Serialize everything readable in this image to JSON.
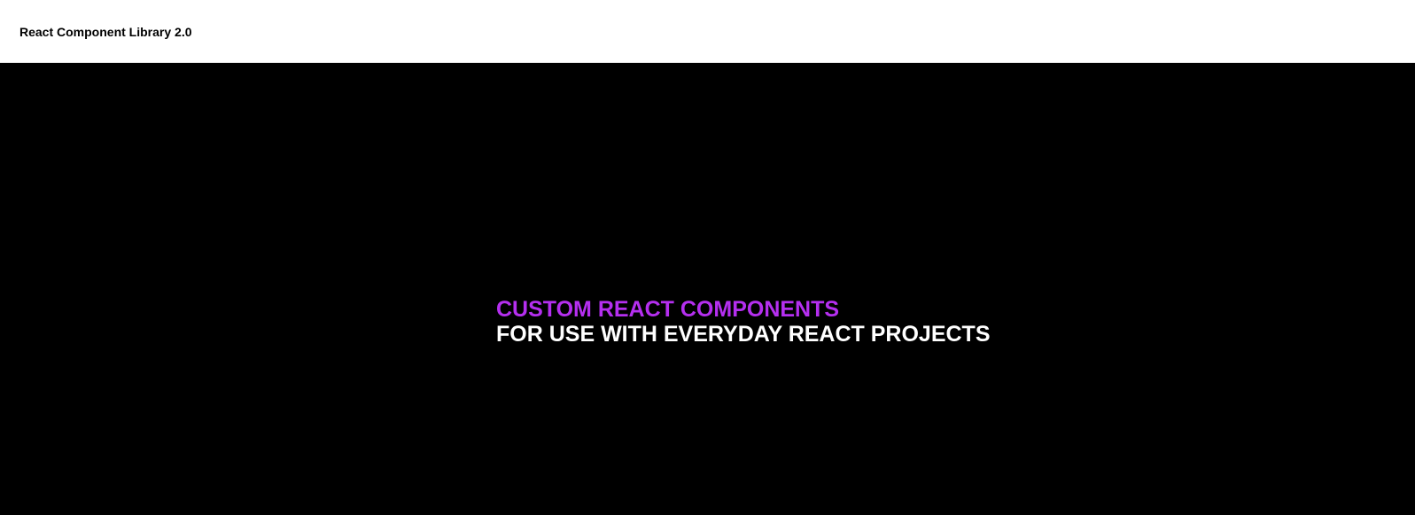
{
  "header": {
    "brand": "React Component Library 2.0"
  },
  "hero": {
    "line1": "CUSTOM REACT COMPONENTS",
    "line2": "FOR USE WITH EVERYDAY REACT PROJECTS"
  },
  "colors": {
    "accent": "#b52ff0",
    "hero_background": "#000000",
    "header_background": "#ffffff"
  }
}
